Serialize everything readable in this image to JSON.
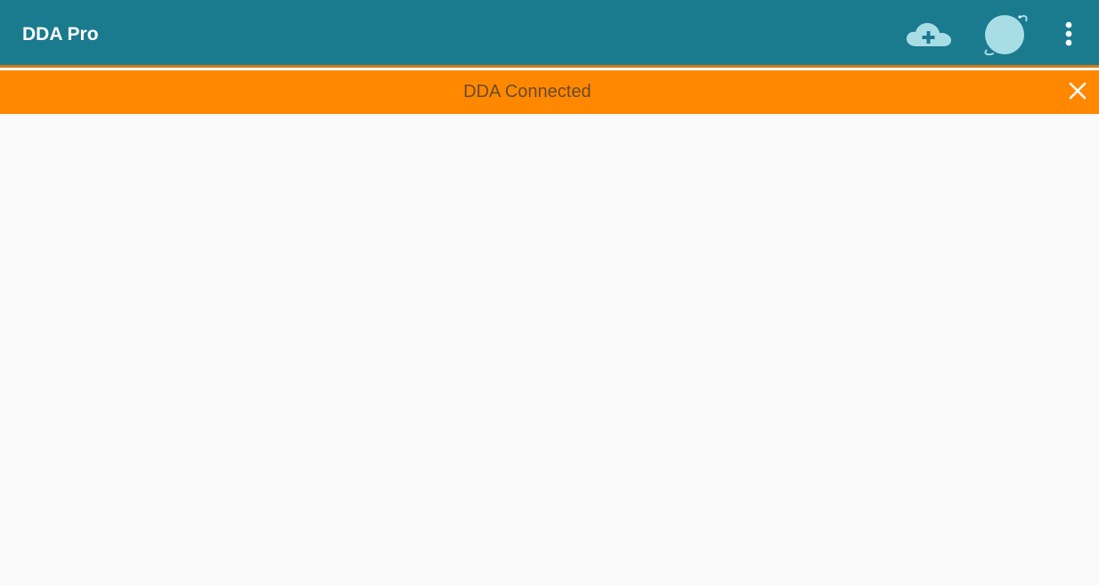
{
  "toolbar": {
    "title": "DDA Pro",
    "background_color": "#1a7a8e",
    "actions": [
      {
        "icon": "cloud-add-icon"
      },
      {
        "icon": "planet-icon"
      },
      {
        "icon": "more-vertical-icon"
      }
    ]
  },
  "banner": {
    "message": "DDA Connected",
    "background_color": "#ff8800",
    "close_icon": "close-icon"
  }
}
